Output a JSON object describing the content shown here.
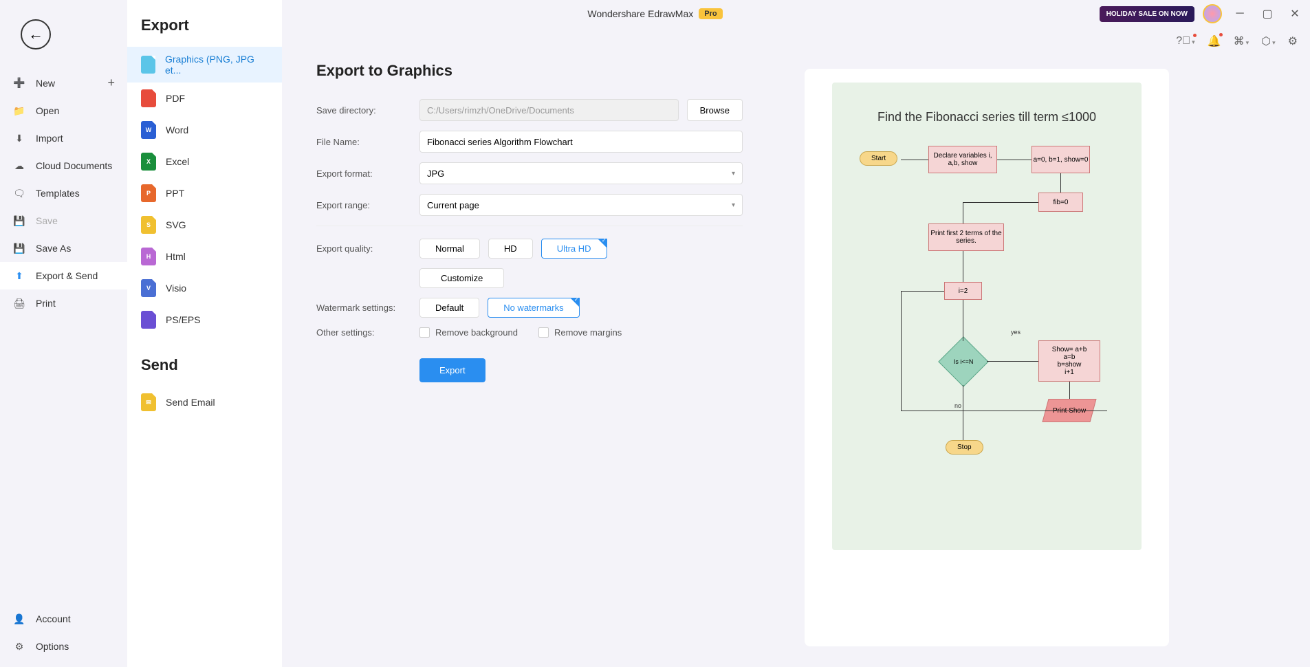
{
  "app": {
    "title": "Wondershare EdrawMax",
    "pro": "Pro",
    "holiday": "HOLIDAY SALE ON NOW"
  },
  "file_menu": {
    "new": "New",
    "open": "Open",
    "import": "Import",
    "cloud": "Cloud Documents",
    "templates": "Templates",
    "save": "Save",
    "saveas": "Save As",
    "export": "Export & Send",
    "print": "Print",
    "account": "Account",
    "options": "Options"
  },
  "export_col": {
    "title": "Export",
    "formats": {
      "graphics": "Graphics (PNG, JPG et...",
      "pdf": "PDF",
      "word": "Word",
      "excel": "Excel",
      "ppt": "PPT",
      "svg": "SVG",
      "html": "Html",
      "visio": "Visio",
      "pseps": "PS/EPS"
    },
    "send_title": "Send",
    "send_email": "Send Email"
  },
  "form": {
    "heading": "Export to Graphics",
    "save_dir_label": "Save directory:",
    "save_dir_value": "C:/Users/rimzh/OneDrive/Documents",
    "browse": "Browse",
    "file_name_label": "File Name:",
    "file_name_value": "Fibonacci series Algorithm Flowchart",
    "format_label": "Export format:",
    "format_value": "JPG",
    "range_label": "Export range:",
    "range_value": "Current page",
    "quality_label": "Export quality:",
    "quality": {
      "normal": "Normal",
      "hd": "HD",
      "uhd": "Ultra HD"
    },
    "customize": "Customize",
    "watermark_label": "Watermark settings:",
    "watermark": {
      "default": "Default",
      "none": "No watermarks"
    },
    "other_label": "Other settings:",
    "remove_bg": "Remove background",
    "remove_margins": "Remove margins",
    "export_btn": "Export"
  },
  "chart_data": {
    "type": "flowchart",
    "title": "Find the Fibonacci series till term ≤1000",
    "nodes": {
      "start": "Start",
      "declare": "Declare variables i, a,b, show",
      "init": "a=0, b=1, show=0",
      "fib0": "fib=0",
      "print2": "Print first 2 terms of the series.",
      "i2": "i=2",
      "cond": "Is i<=N",
      "calc": "Show= a+b\na=b\nb=show\ni+1",
      "printshow": "Print Show",
      "stop": "Stop"
    },
    "edge_labels": {
      "yes": "yes",
      "no": "no"
    }
  }
}
